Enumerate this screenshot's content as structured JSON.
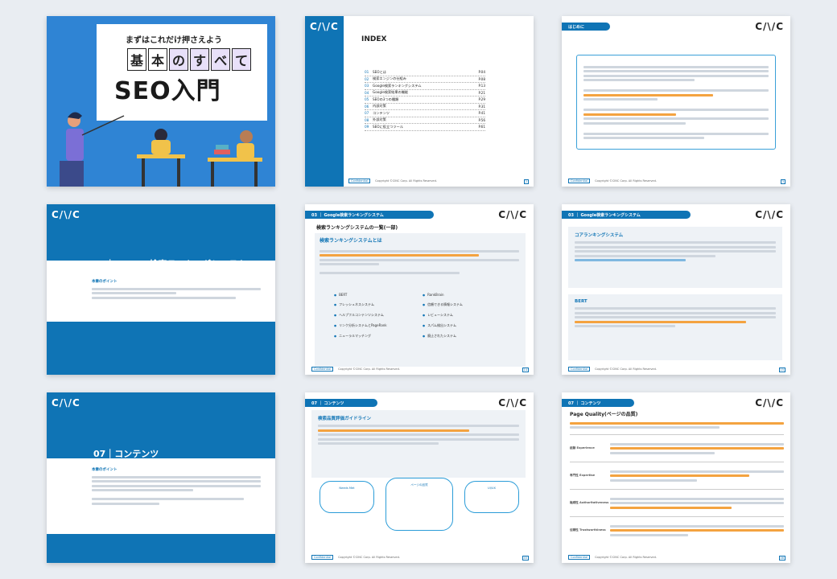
{
  "brand": {
    "logo": "C/\\/C"
  },
  "footer": {
    "conf": "Confidential",
    "copy": "Copyright ©CINC Corp. All Rights Reserved."
  },
  "s1": {
    "sub": "まずはこれだけ押さえよう",
    "t1": [
      "基",
      "本",
      "の",
      "す",
      "べ",
      "て"
    ],
    "t2": "SEO入門"
  },
  "s2": {
    "title": "INDEX",
    "items": [
      {
        "n": "01",
        "t": "SEOとは",
        "p": "P.04"
      },
      {
        "n": "02",
        "t": "検索エンジンの仕組み",
        "p": "P.08"
      },
      {
        "n": "03",
        "t": "Google検索ランキングシステム",
        "p": "P.13"
      },
      {
        "n": "04",
        "t": "Google検索結果の機能",
        "p": "P.21"
      },
      {
        "n": "05",
        "t": "SEOの3つの種類",
        "p": "P.29"
      },
      {
        "n": "06",
        "t": "内部対策",
        "p": "P.31"
      },
      {
        "n": "07",
        "t": "コンテンツ",
        "p": "P.41"
      },
      {
        "n": "08",
        "t": "外部対策",
        "p": "P.56"
      },
      {
        "n": "09",
        "t": "SEOに役立つツール",
        "p": "P.61"
      }
    ],
    "page": "2"
  },
  "s3": {
    "tab": "はじめに",
    "page": "3"
  },
  "s4": {
    "title": "03｜Google検索ランキングシステム",
    "point": "本章のポイント"
  },
  "s5": {
    "tab": "03 ｜ Google検索ランキングシステム",
    "heading": "検索ランキングシステムの一覧(一部)",
    "sec": "検索ランキングシステムとは",
    "items": [
      "BERT",
      "RankBrain",
      "フレッシュネスシステム",
      "信頼できる情報システム",
      "ヘルプフルコンテンツシステム",
      "レビューシステム",
      "リンク分析システムとPageRank",
      "スパム検出システム",
      "ニューラルマッチング",
      "廃止されたシステム"
    ],
    "page": "14"
  },
  "s6": {
    "tab": "03 ｜ Google検索ランキングシステム",
    "p1": "コアランキングシステム",
    "p2": "BERT",
    "page": "15"
  },
  "s7": {
    "title": "07｜コンテンツ",
    "point": "本章のポイント"
  },
  "s8": {
    "tab": "07 ｜ コンテンツ",
    "sec": "検索品質評価ガイドライン",
    "c1": "Needs Met",
    "c2": "ページの品質",
    "c3": "UI/UX",
    "page": "45"
  },
  "s9": {
    "tab": "07 ｜ コンテンツ",
    "heading": "Page Quality(ページの品質)",
    "rows": [
      "経験 Experience",
      "専門性 Expertise",
      "権威性 Authoritativeness",
      "信頼性 Trustworthiness"
    ],
    "page": "46"
  }
}
